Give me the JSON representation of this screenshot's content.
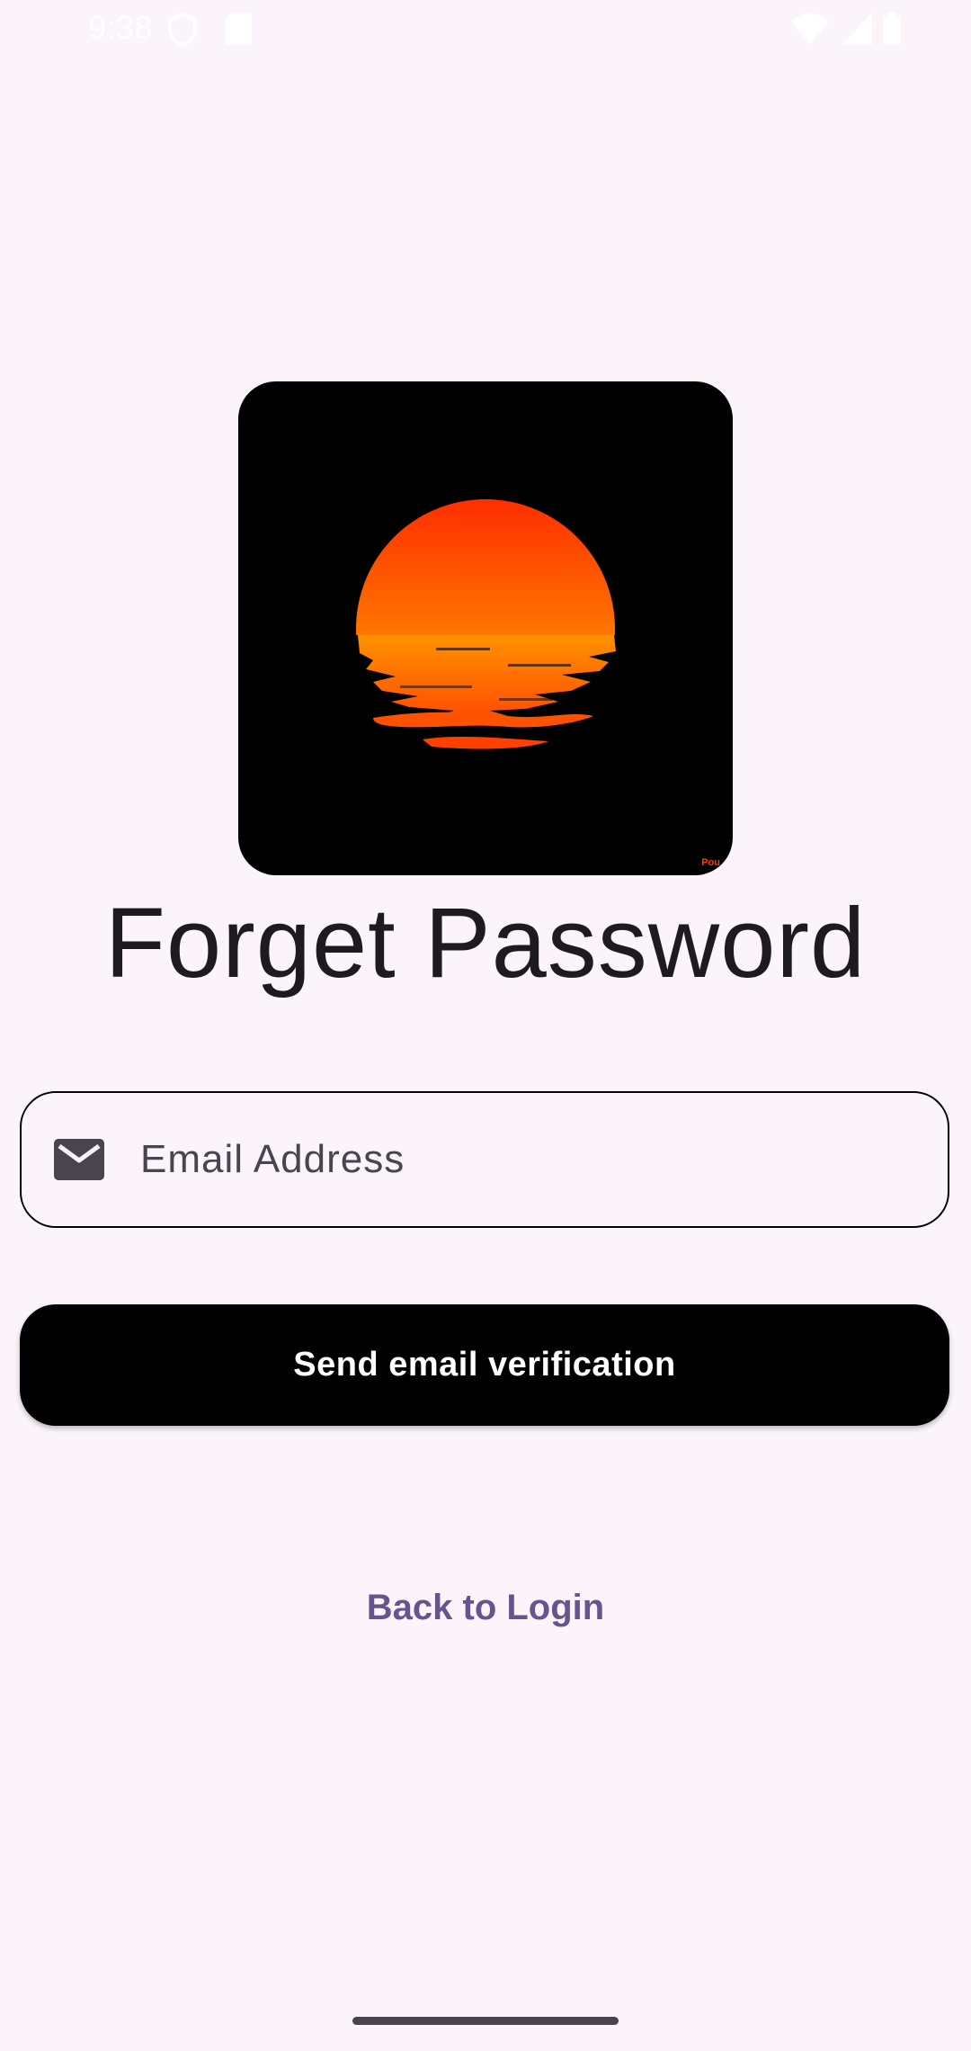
{
  "status_bar": {
    "time": "9:38",
    "icons": [
      "vpn-shield-icon",
      "sd-card-icon",
      "wifi-icon",
      "cell-signal-icon",
      "battery-icon"
    ]
  },
  "logo": {
    "name": "sunset-logo",
    "mark_text": "Pou",
    "colors": {
      "background": "#000000",
      "sun_top": "#ff2e00",
      "sun_bottom": "#ff9400"
    }
  },
  "page": {
    "title": "Forget Password"
  },
  "form": {
    "email": {
      "icon": "mail-icon",
      "placeholder": "Email Address",
      "value": ""
    },
    "send_button_label": "Send email verification"
  },
  "footer": {
    "back_link_label": "Back to Login"
  },
  "colors": {
    "background": "#fcf4fb",
    "primary_button": "#000000",
    "link": "#65558f",
    "text": "#1d1b20"
  }
}
